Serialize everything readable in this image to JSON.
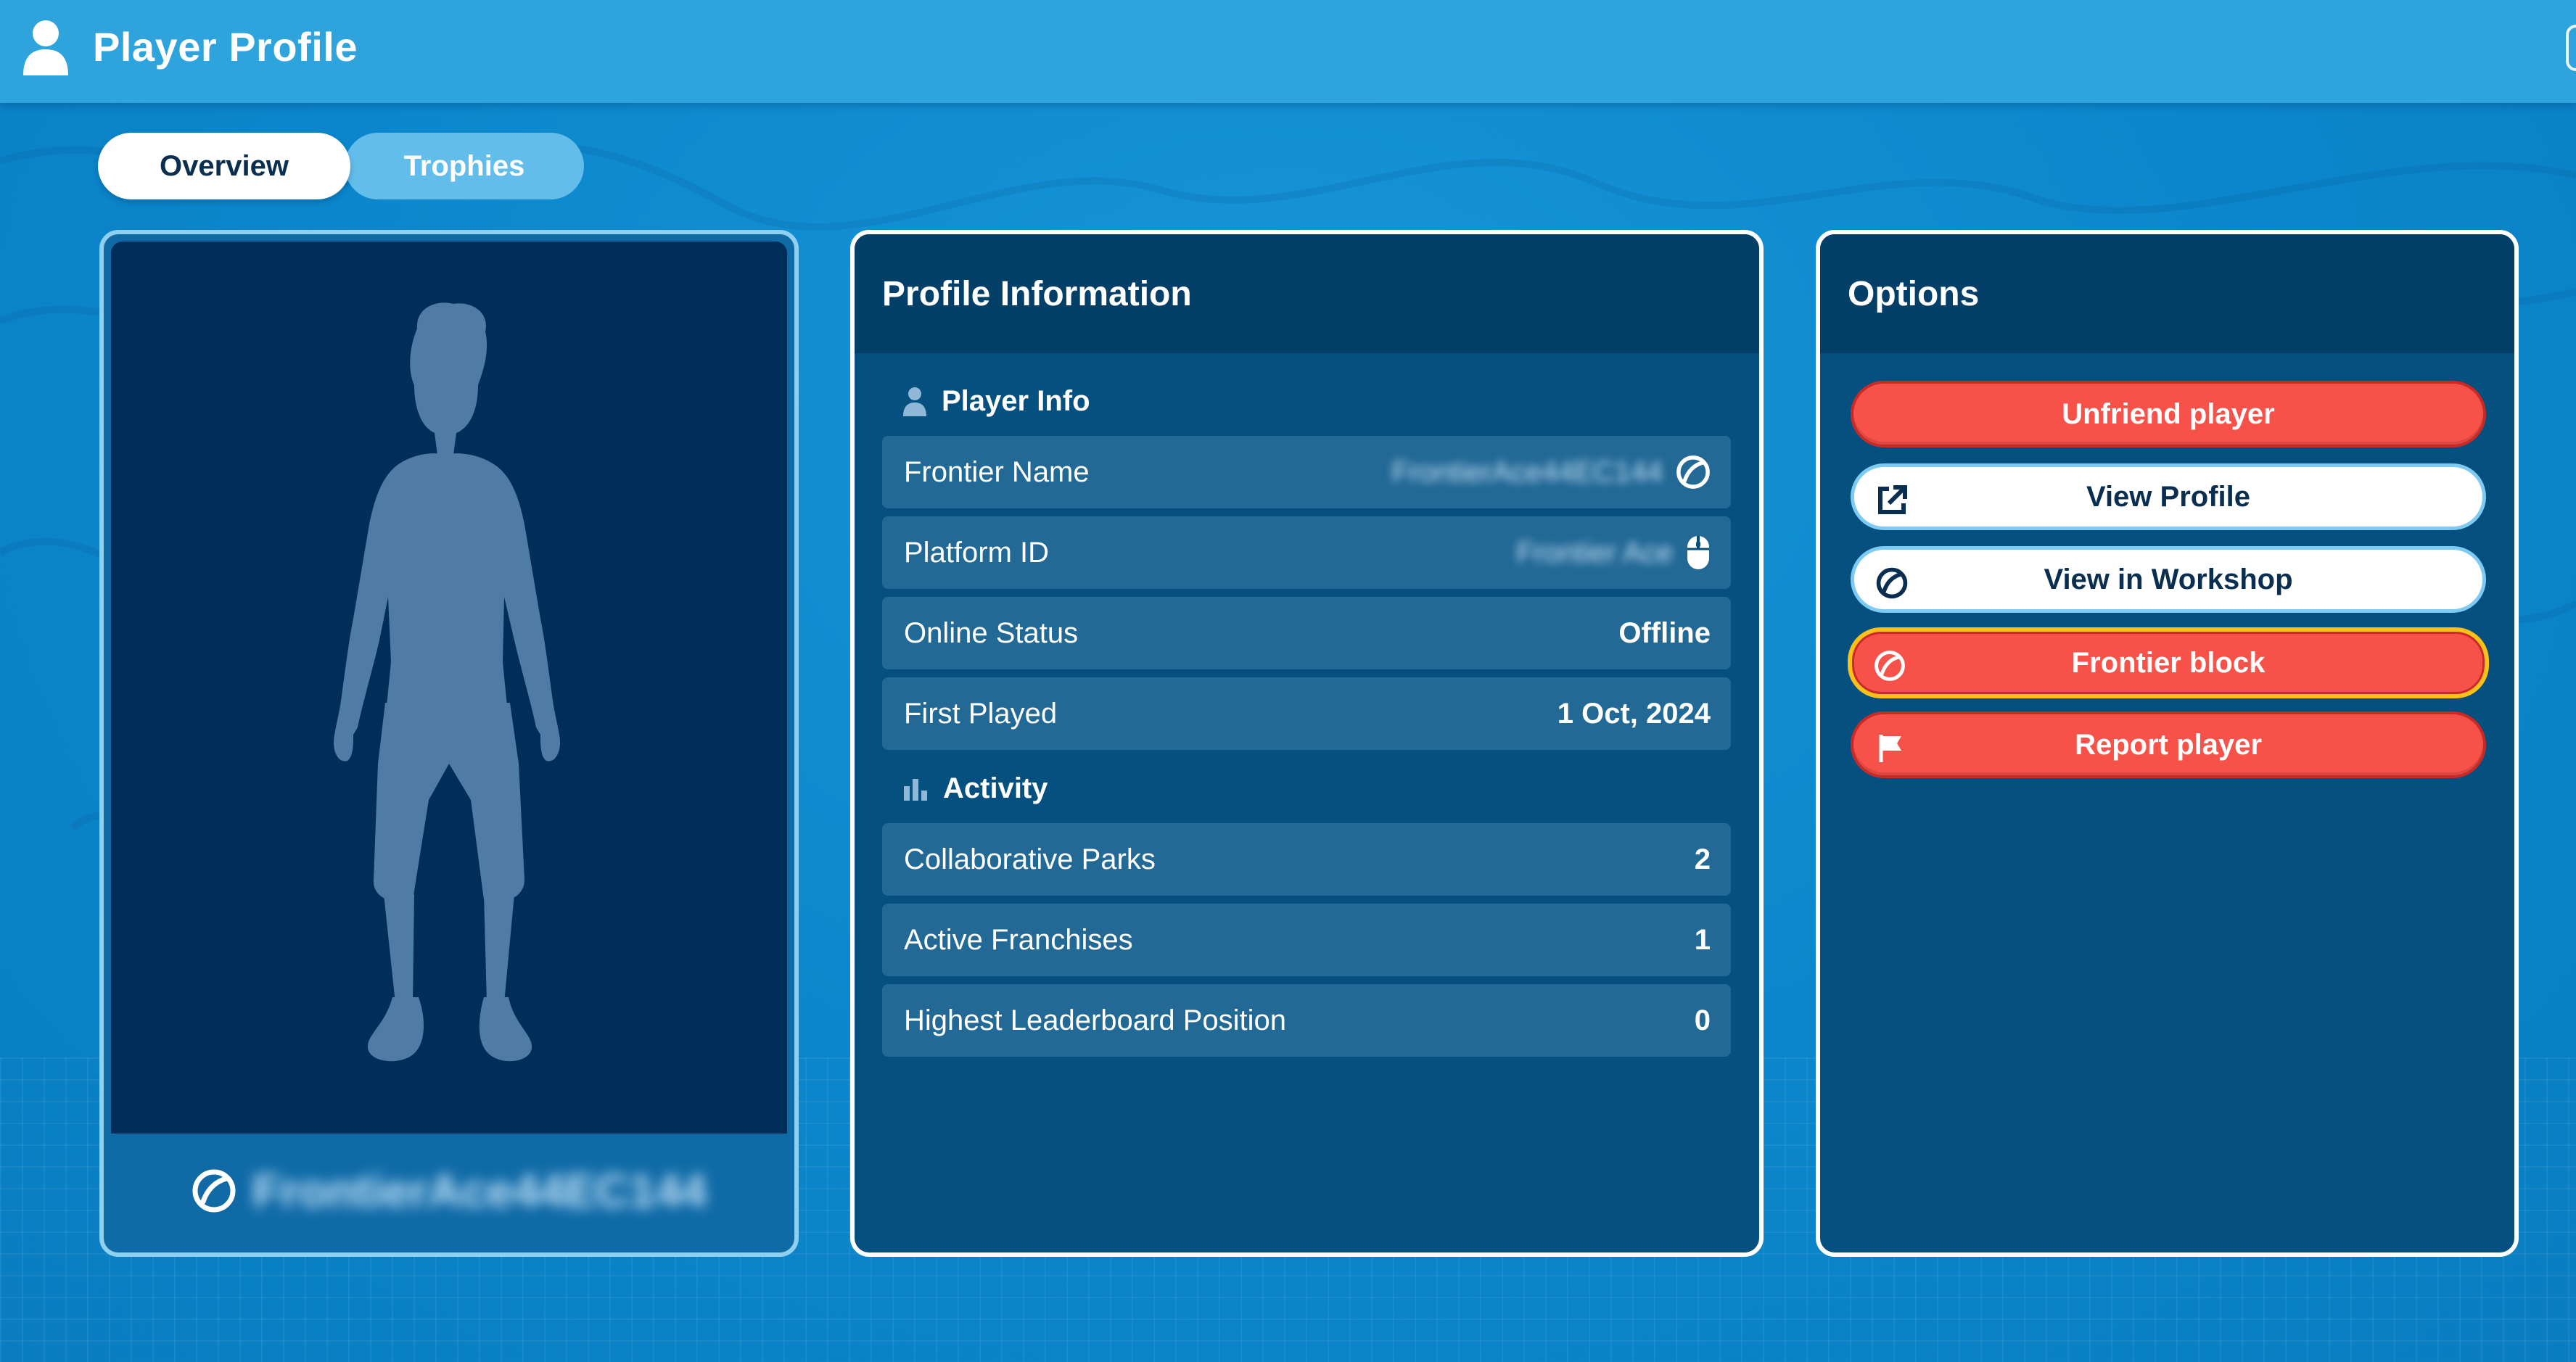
{
  "header": {
    "title": "Player Profile",
    "icon": "user-icon"
  },
  "tabs": [
    {
      "label": "Overview",
      "active": true
    },
    {
      "label": "Trophies",
      "active": false
    }
  ],
  "avatar_card": {
    "player_name": "FrontierAce44EC144",
    "name_blurred": true,
    "platform_icon": "frontier-icon"
  },
  "profile_info": {
    "title": "Profile Information",
    "player_info": {
      "title": "Player Info",
      "icon": "user-icon",
      "rows": [
        {
          "label": "Frontier Name",
          "value": "FrontierAce44EC144",
          "value_blurred": true,
          "icon": "frontier-icon"
        },
        {
          "label": "Platform ID",
          "value": "Frontier Ace",
          "value_blurred": true,
          "icon": "mouse-icon"
        },
        {
          "label": "Online Status",
          "value": "Offline"
        },
        {
          "label": "First Played",
          "value": "1 Oct, 2024"
        }
      ]
    },
    "activity": {
      "title": "Activity",
      "icon": "bar-chart-icon",
      "rows": [
        {
          "label": "Collaborative Parks",
          "value": "2"
        },
        {
          "label": "Active Franchises",
          "value": "1"
        },
        {
          "label": "Highest Leaderboard Position",
          "value": "0"
        }
      ]
    }
  },
  "options": {
    "title": "Options",
    "buttons": [
      {
        "label": "Unfriend player",
        "style": "red",
        "icon": null
      },
      {
        "label": "View Profile",
        "style": "white",
        "icon": "external-link-icon"
      },
      {
        "label": "View in Workshop",
        "style": "white",
        "icon": "frontier-icon"
      },
      {
        "label": "Frontier block",
        "style": "red",
        "icon": "frontier-icon",
        "focused": true
      },
      {
        "label": "Report player",
        "style": "red",
        "icon": "flag-icon"
      }
    ]
  },
  "colors": {
    "background": "#0b86cc",
    "topbar": "#2ea3dc",
    "panel": "#05507f",
    "panel_header": "#043f68",
    "danger": "#f7524a",
    "focus": "#f9c11a",
    "text_dark": "#0a2e4f"
  }
}
